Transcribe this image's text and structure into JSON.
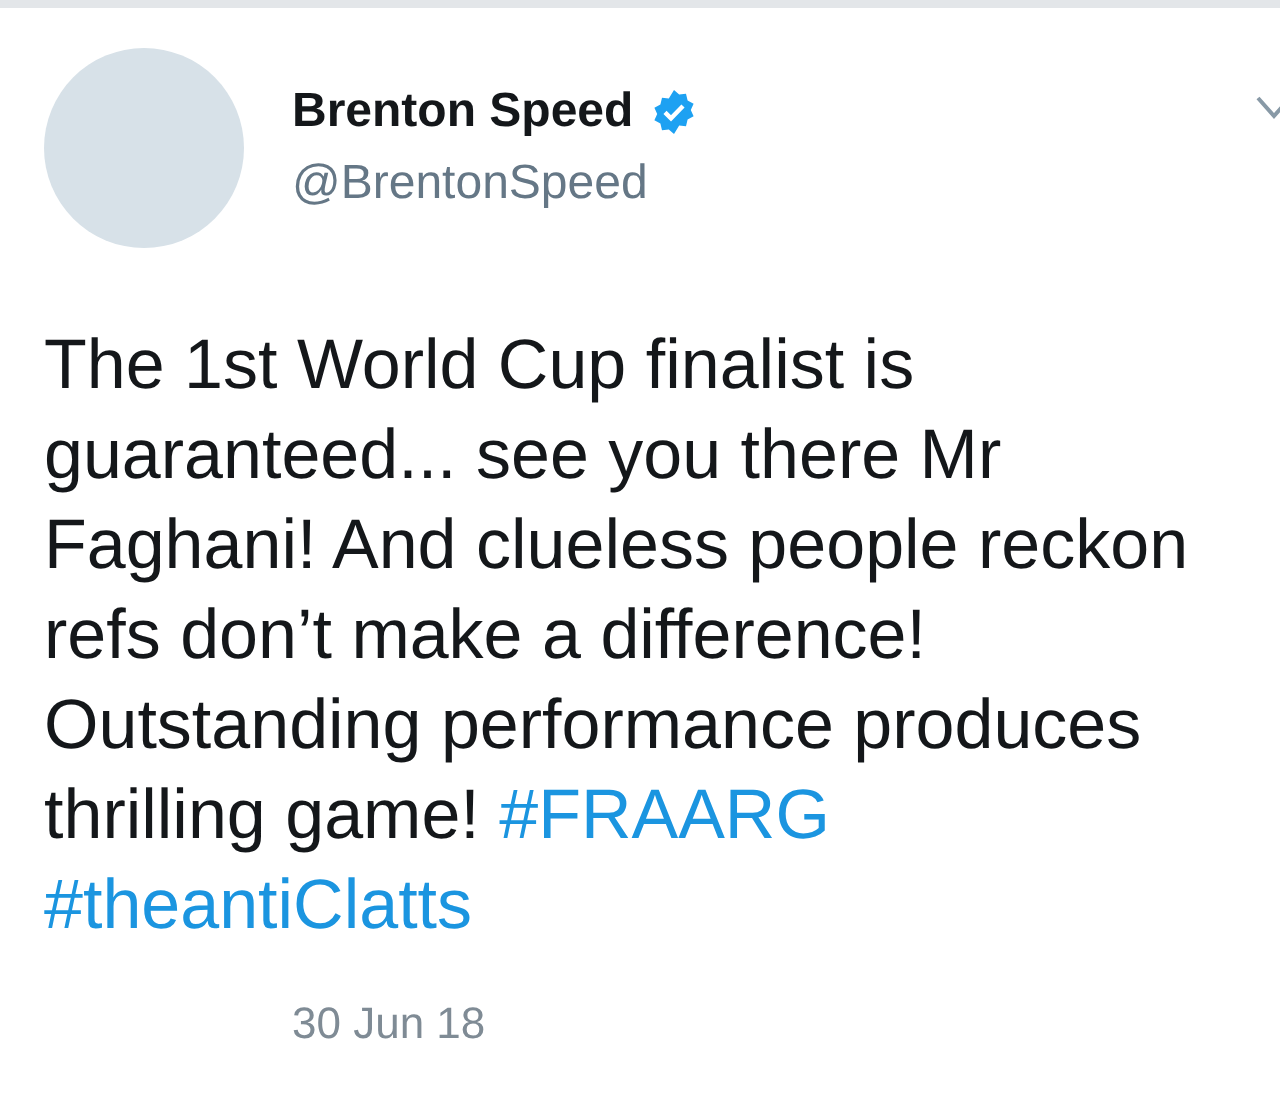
{
  "author": {
    "name": "Brenton Speed",
    "verified": true,
    "handle": "@BrentonSpeed"
  },
  "tweet": {
    "text": "The 1st World Cup finalist is guaranteed... see you there Mr Faghani! And clueless people reckon refs don’t make a difference! Outstanding performance produces thrilling game!",
    "hashtags": [
      "#FRAARG",
      "#theantiClatts"
    ]
  },
  "timestamp": "30 Jun 18"
}
